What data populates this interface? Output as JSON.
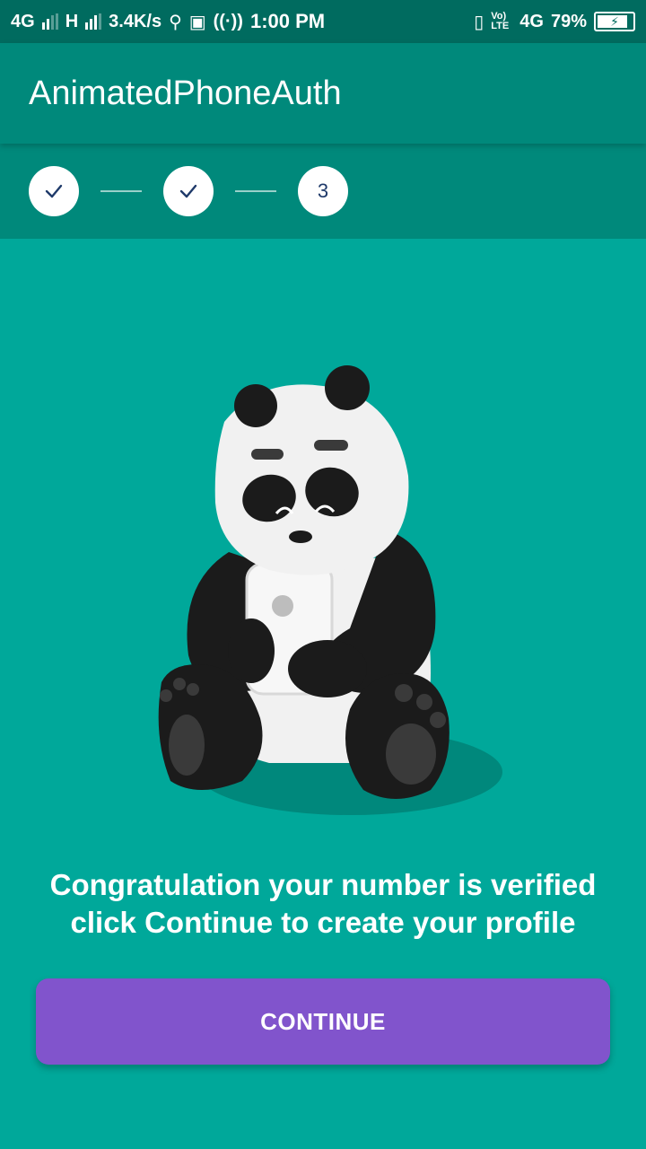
{
  "status_bar": {
    "network_1": "4G",
    "network_2": "H",
    "speed": "3.4K/s",
    "time": "1:00 PM",
    "volte": "Vo) LTE",
    "network_3": "4G",
    "battery_percent": "79%",
    "battery_level": 0.79
  },
  "toolbar": {
    "title": "AnimatedPhoneAuth"
  },
  "stepper": {
    "steps": [
      {
        "state": "done",
        "icon": "check-icon"
      },
      {
        "state": "done",
        "icon": "check-icon"
      },
      {
        "state": "current",
        "label": "3"
      }
    ]
  },
  "illustration": {
    "description_icon": "panda-holding-phone-icon"
  },
  "message": {
    "line1": "Congratulation your number is verified",
    "line2": "click Continue to create your profile"
  },
  "continue_label": "CONTINUE",
  "colors": {
    "status_bar": "#006b5f",
    "toolbar": "#00897b",
    "background": "#00a89a",
    "button": "#8154cc"
  }
}
